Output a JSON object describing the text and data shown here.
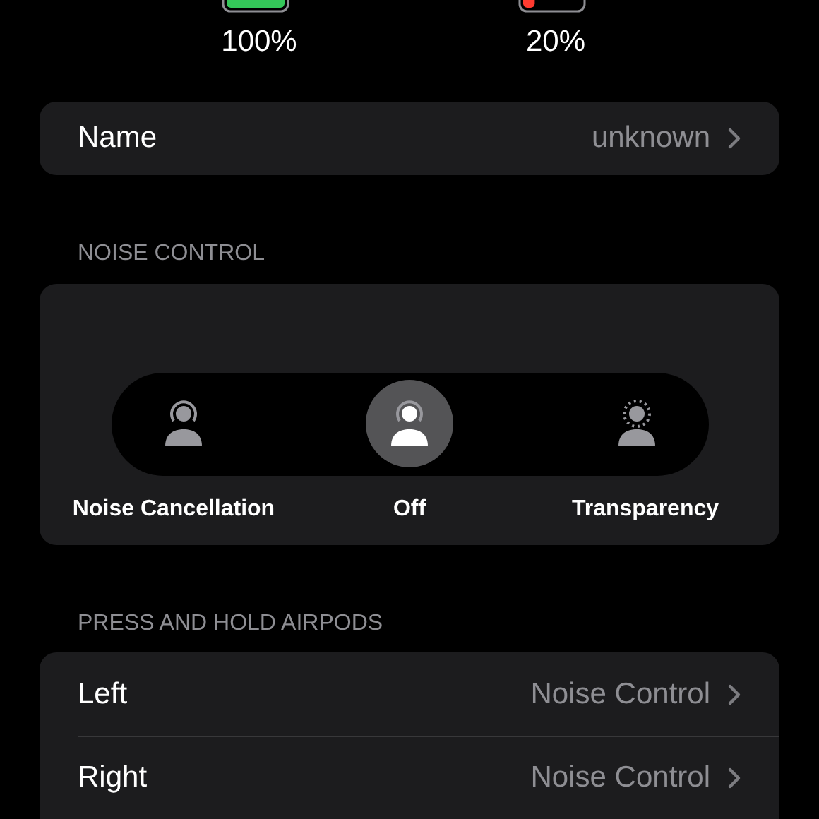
{
  "batteries": [
    {
      "level": 1.0,
      "reading": "100%"
    },
    {
      "level": 0.2,
      "reading": "20%"
    }
  ],
  "name_row": {
    "label": "Name",
    "value": "unknown"
  },
  "noise_control": {
    "header": "NOISE CONTROL",
    "modes": [
      {
        "kind": "cancellation",
        "label": "Noise Cancellation",
        "selected": false
      },
      {
        "kind": "off",
        "label": "Off",
        "selected": true
      },
      {
        "kind": "transparency",
        "label": "Transparency",
        "selected": false
      }
    ]
  },
  "press_and_hold": {
    "header": "PRESS AND HOLD AIRPODS",
    "rows": [
      {
        "label": "Left",
        "value": "Noise Control"
      },
      {
        "label": "Right",
        "value": "Noise Control"
      }
    ]
  }
}
